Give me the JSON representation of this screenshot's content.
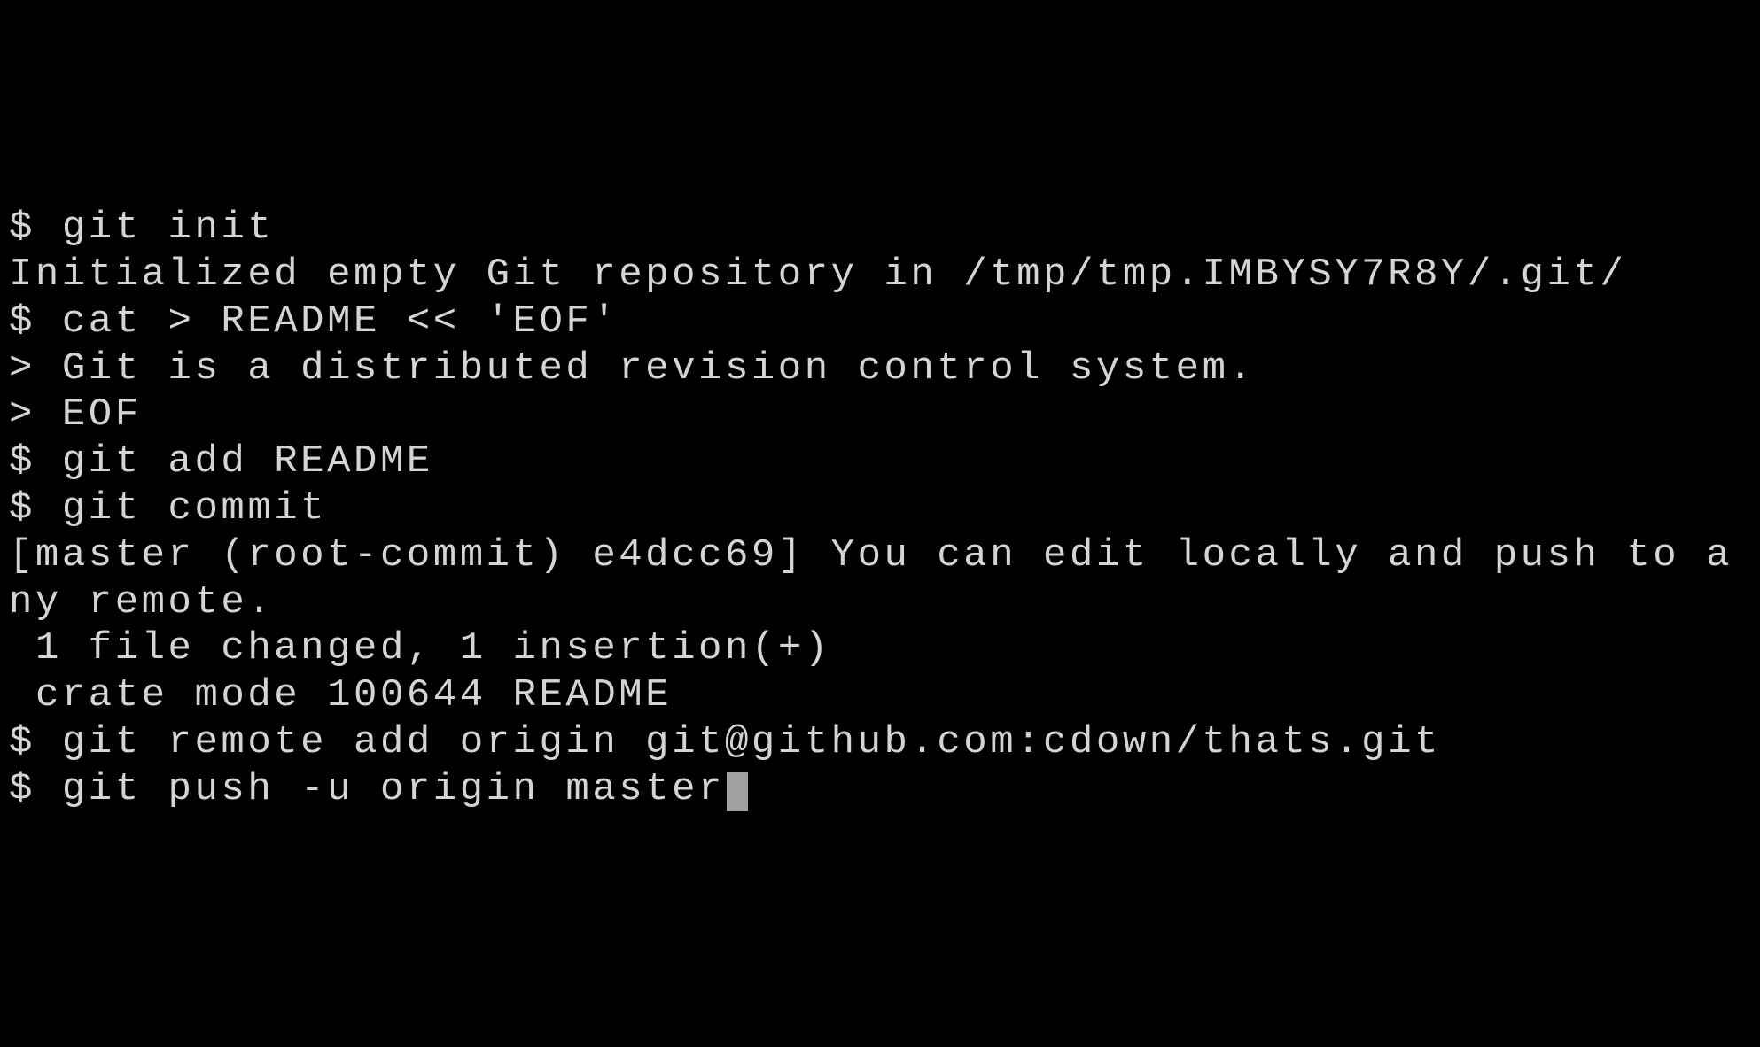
{
  "terminal": {
    "lines": [
      "$ git init",
      "Initialized empty Git repository in /tmp/tmp.IMBYSY7R8Y/.git/",
      "$ cat > README << 'EOF'",
      "> Git is a distributed revision control system.",
      "> EOF",
      "$ git add README",
      "$ git commit",
      "[master (root-commit) e4dcc69] You can edit locally and push to any remote.",
      " 1 file changed, 1 insertion(+)",
      " crate mode 100644 README",
      "$ git remote add origin git@github.com:cdown/thats.git"
    ],
    "current_line": "$ git push -u origin master"
  }
}
